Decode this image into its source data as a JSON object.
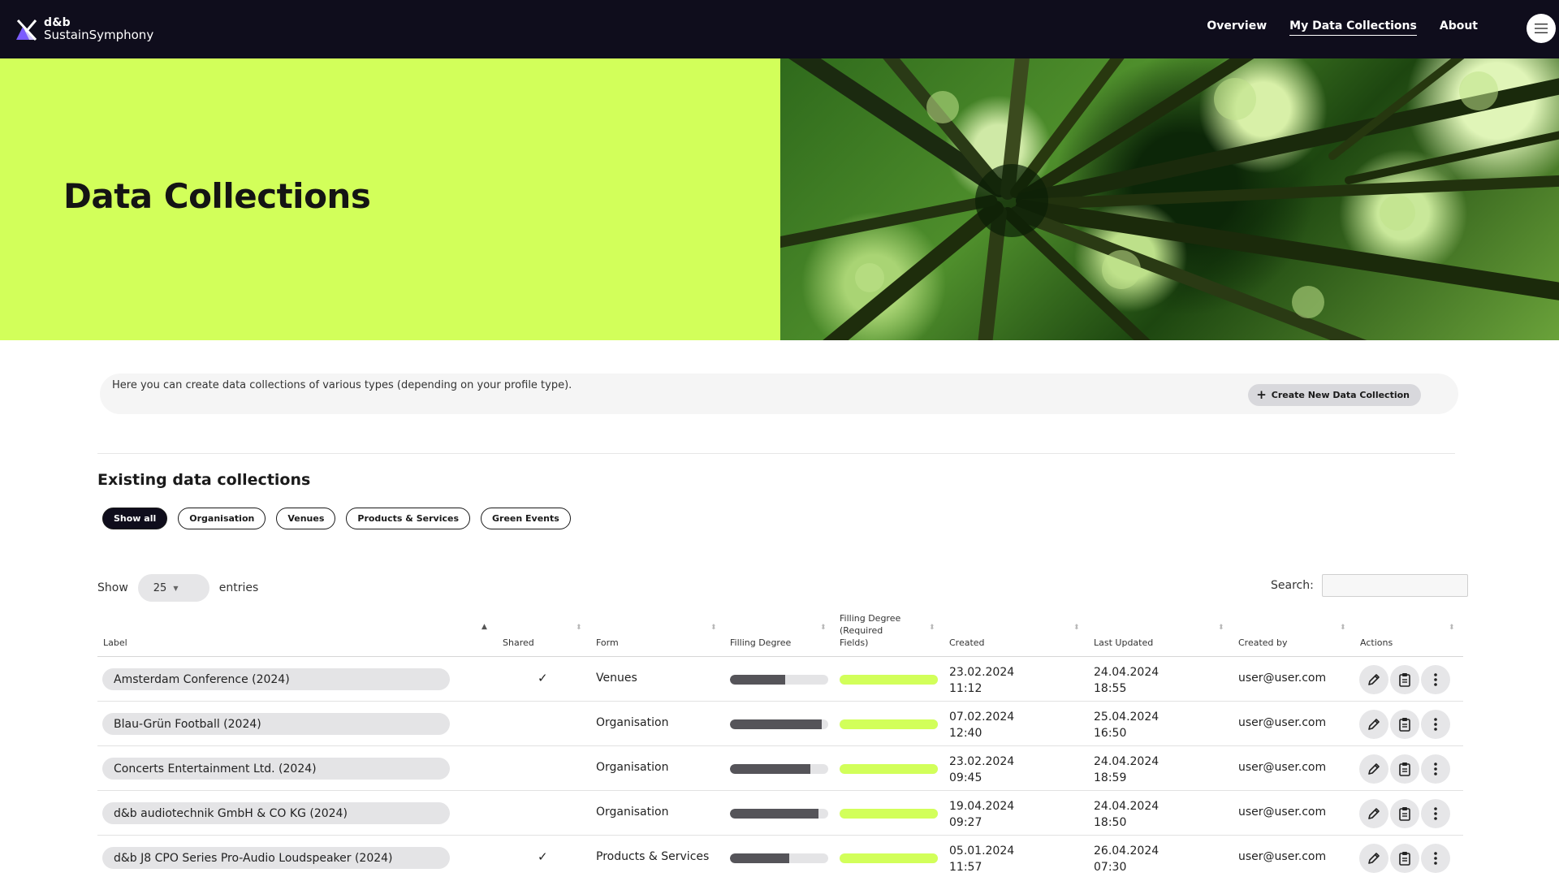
{
  "nav": {
    "logo_top": "d&b",
    "logo_bottom": "SustainSymphony",
    "links": [
      "Overview",
      "My Data Collections",
      "About"
    ],
    "active_link": "My Data Collections"
  },
  "hero": {
    "title": "Data Collections"
  },
  "info": {
    "text": "Here you can create data collections of various types (depending on your profile type).",
    "create_label": "Create New Data Collection"
  },
  "section": {
    "title": "Existing data collections"
  },
  "filters": [
    "Show all",
    "Organisation",
    "Venues",
    "Products & Services",
    "Green Events"
  ],
  "active_filter": "Show all",
  "table_controls": {
    "show_label": "Show",
    "entries_value": "25",
    "entries_label": "entries",
    "search_label": "Search:"
  },
  "columns": {
    "label": "Label",
    "shared": "Shared",
    "form": "Form",
    "filling": "Filling Degree",
    "filling_required_1": "Filling Degree",
    "filling_required_2": "(Required",
    "filling_required_3": "Fields)",
    "created": "Created",
    "updated": "Last Updated",
    "created_by": "Created by",
    "actions": "Actions"
  },
  "rows": [
    {
      "label": "Amsterdam Conference (2024)",
      "shared": true,
      "form": "Venues",
      "filling": 0.56,
      "filling_required": 1.0,
      "created_date": "23.02.2024",
      "created_time": "11:12",
      "updated_date": "24.04.2024",
      "updated_time": "18:55",
      "created_by": "user@user.com"
    },
    {
      "label": "Blau-Grün Football (2024)",
      "shared": false,
      "form": "Organisation",
      "filling": 0.93,
      "filling_required": 1.0,
      "created_date": "07.02.2024",
      "created_time": "12:40",
      "updated_date": "25.04.2024",
      "updated_time": "16:50",
      "created_by": "user@user.com"
    },
    {
      "label": "Concerts Entertainment Ltd. (2024)",
      "shared": false,
      "form": "Organisation",
      "filling": 0.82,
      "filling_required": 1.0,
      "created_date": "23.02.2024",
      "created_time": "09:45",
      "updated_date": "24.04.2024",
      "updated_time": "18:59",
      "created_by": "user@user.com"
    },
    {
      "label": "d&b audiotechnik GmbH & CO KG (2024)",
      "shared": false,
      "form": "Organisation",
      "filling": 0.9,
      "filling_required": 1.0,
      "created_date": "19.04.2024",
      "created_time": "09:27",
      "updated_date": "24.04.2024",
      "updated_time": "18:50",
      "created_by": "user@user.com"
    },
    {
      "label": "d&b J8 CPO Series Pro-Audio Loudspeaker (2024)",
      "shared": true,
      "form": "Products & Services",
      "filling": 0.6,
      "filling_required": 1.0,
      "created_date": "05.01.2024",
      "created_time": "11:57",
      "updated_date": "26.04.2024",
      "updated_time": "07:30",
      "created_by": "user@user.com"
    }
  ],
  "icons": {
    "edit": "pencil-icon",
    "copy": "clipboard-icon",
    "more": "more-vertical-icon",
    "menu": "hamburger-menu-icon",
    "plus": "plus-icon",
    "check": "checkmark-icon"
  },
  "colors": {
    "nav_bg": "#0f0d1c",
    "accent": "#d2ff5a",
    "bar_dark": "#555459",
    "logo_purple": "#7b5cff"
  }
}
